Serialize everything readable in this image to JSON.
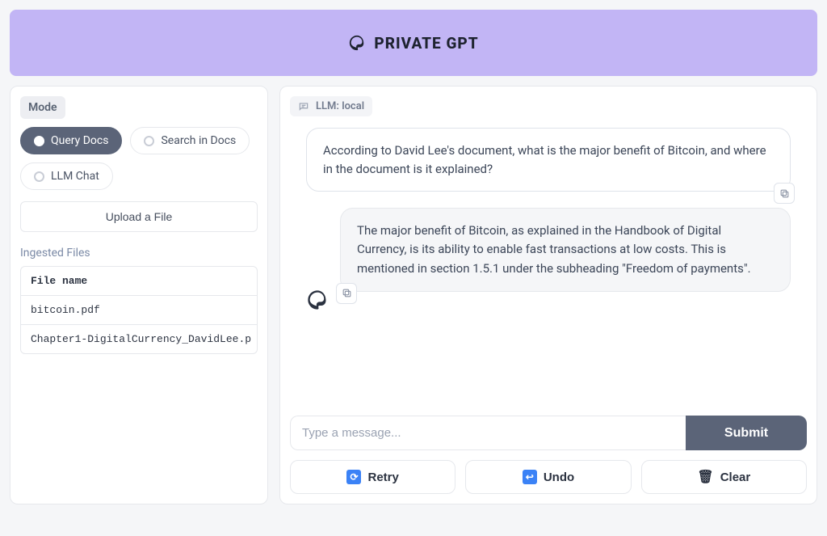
{
  "header": {
    "title": "PRIVATE GPT"
  },
  "sidebar": {
    "mode_label": "Mode",
    "modes": [
      "Query Docs",
      "Search in Docs",
      "LLM Chat"
    ],
    "selected_mode_index": 0,
    "upload_label": "Upload a File",
    "ingested_label": "Ingested Files",
    "file_header": "File name",
    "files": [
      "bitcoin.pdf",
      "Chapter1-DigitalCurrency_DavidLee.p"
    ]
  },
  "chat": {
    "llm_badge": "LLM: local",
    "user_message": "According to David Lee's document, what is the major benefit of Bitcoin, and where in the document is it explained?",
    "bot_message": "The major benefit of Bitcoin, as explained in the Handbook of Digital Currency, is its ability to enable fast transactions at low costs. This is mentioned in section 1.5.1 under the subheading \"Freedom of payments\".",
    "input_placeholder": "Type a message...",
    "submit_label": "Submit",
    "retry_label": "Retry",
    "undo_label": "Undo",
    "clear_label": "Clear"
  }
}
